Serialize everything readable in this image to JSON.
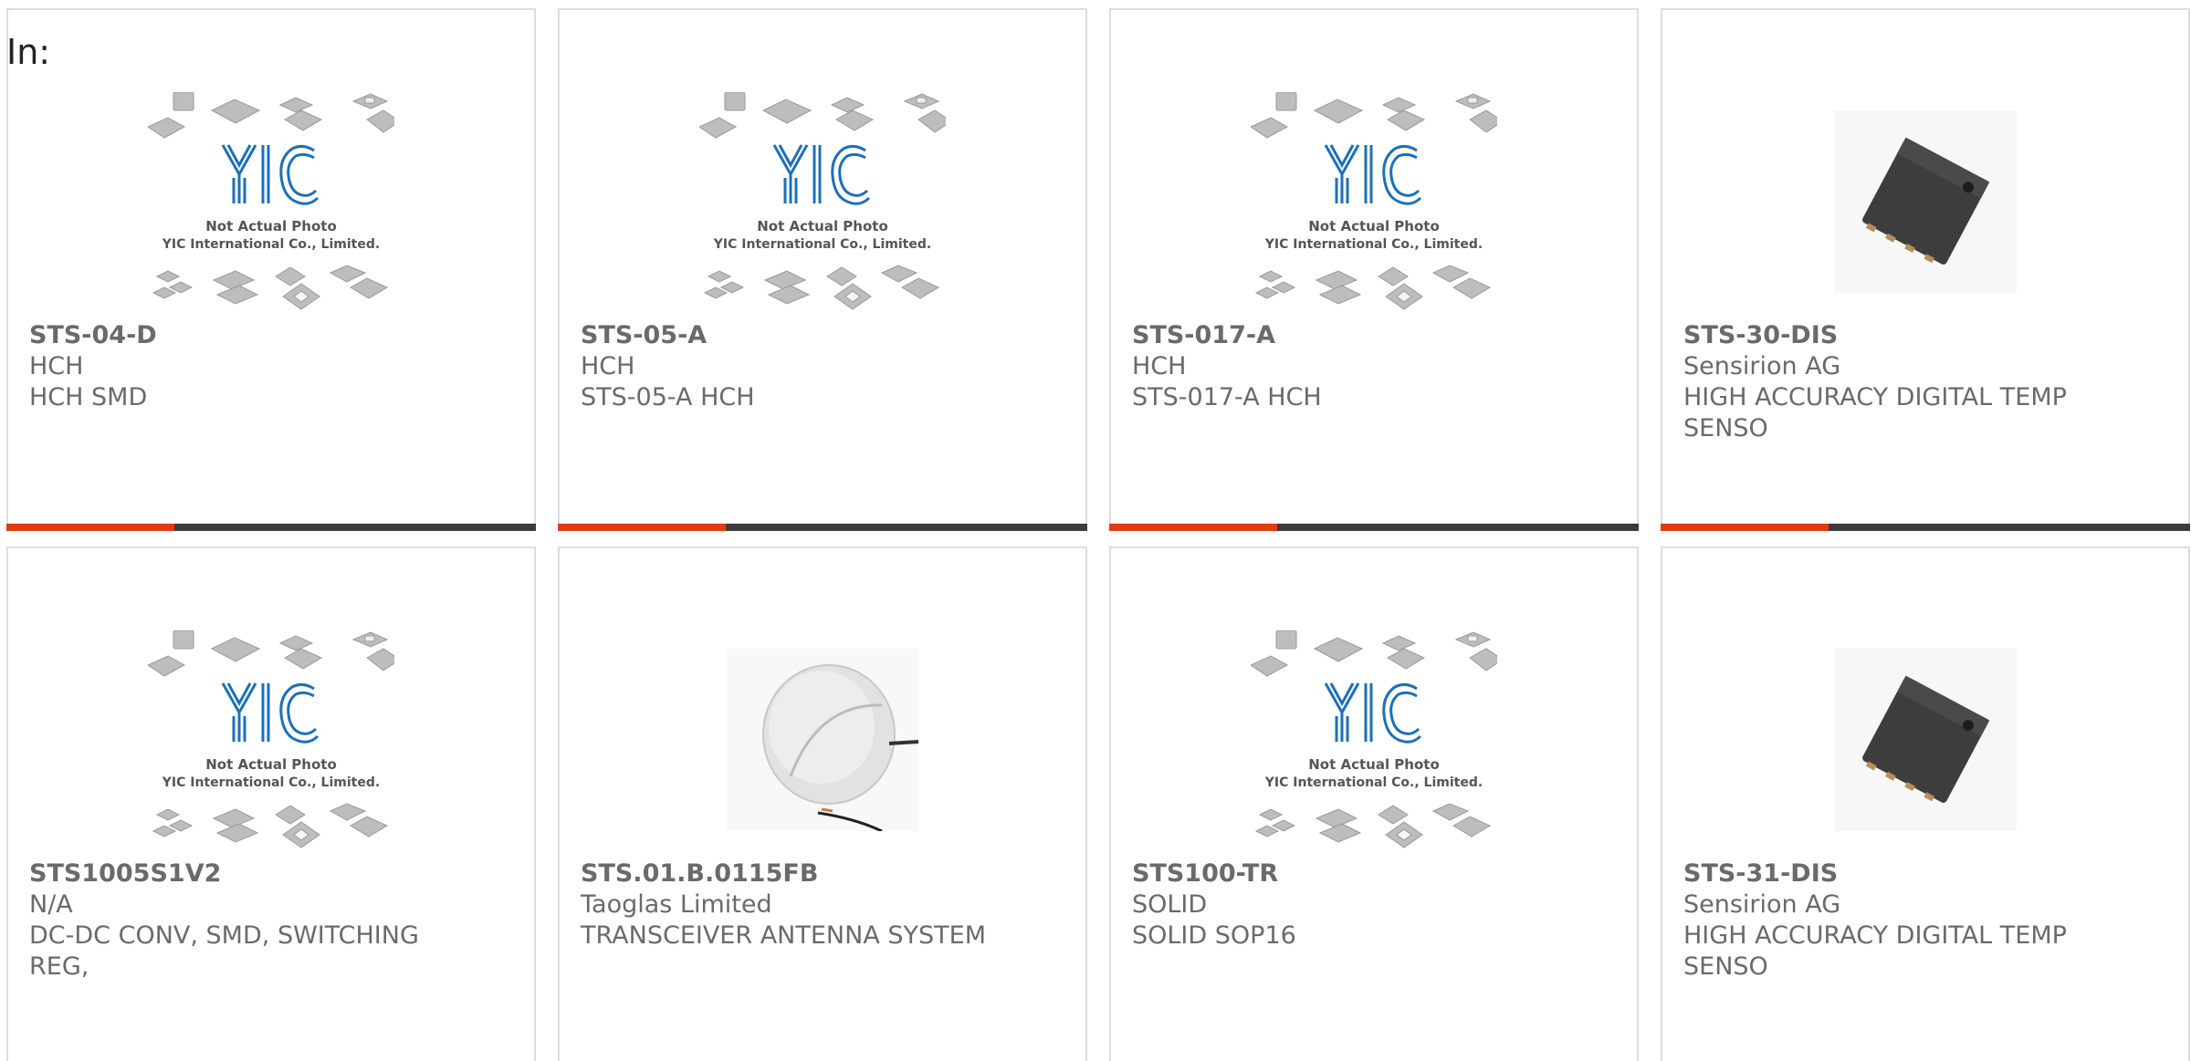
{
  "filter_label": "In:",
  "placeholder_text": {
    "line1": "Not Actual Photo",
    "line2": "YIC International Co., Limited.",
    "logo": "YIC"
  },
  "colors": {
    "accent": "#e33a0f",
    "bar": "#3c3c3c",
    "text": "#6a6a6a",
    "logo_blue": "#1e6fb8"
  },
  "products": [
    {
      "part": "STS-04-D",
      "maker": "HCH",
      "desc": "HCH SMD",
      "image": "placeholder"
    },
    {
      "part": "STS-05-A",
      "maker": "HCH",
      "desc": "STS-05-A HCH",
      "image": "placeholder"
    },
    {
      "part": "STS-017-A",
      "maker": "HCH",
      "desc": "STS-017-A HCH",
      "image": "placeholder"
    },
    {
      "part": "STS-30-DIS",
      "maker": "Sensirion AG",
      "desc": "HIGH ACCURACY DIGITAL TEMP SENSO",
      "image": "chip"
    },
    {
      "part": "STS1005S1V2",
      "maker": "N/A",
      "desc": "DC-DC CONV, SMD, SWITCHING REG,",
      "image": "placeholder"
    },
    {
      "part": "STS.01.B.0115FB",
      "maker": "Taoglas Limited",
      "desc": "TRANSCEIVER ANTENNA SYSTEM",
      "image": "antenna"
    },
    {
      "part": "STS100-TR",
      "maker": "SOLID",
      "desc": "SOLID SOP16",
      "image": "placeholder"
    },
    {
      "part": "STS-31-DIS",
      "maker": "Sensirion AG",
      "desc": "HIGH ACCURACY DIGITAL TEMP SENSO",
      "image": "chip"
    }
  ]
}
